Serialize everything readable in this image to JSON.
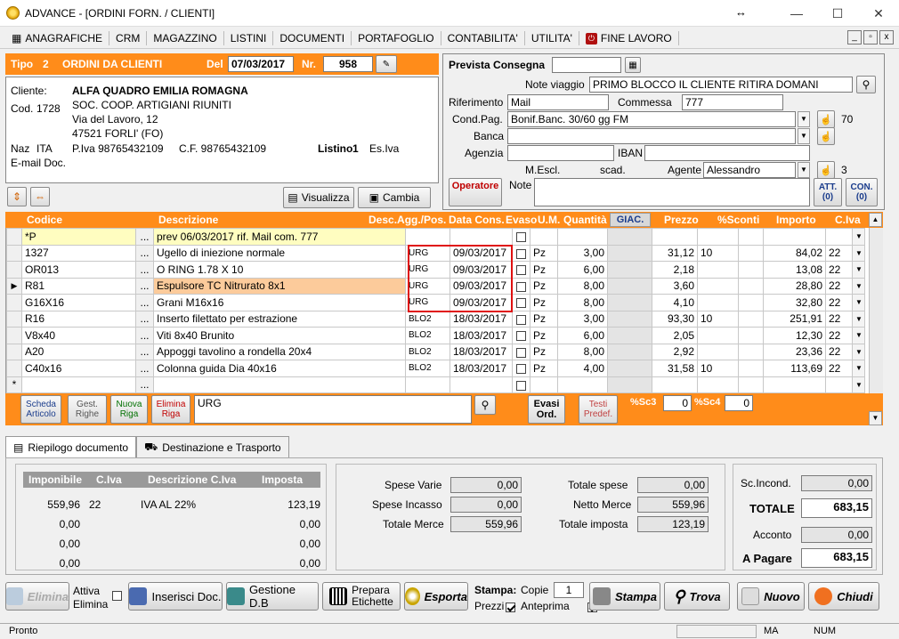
{
  "window": {
    "title": "ADVANCE - [ORDINI FORN. / CLIENTI]",
    "resize_glyph": "↔",
    "minimize": "—",
    "maximize": "☐",
    "close": "✕"
  },
  "menu": {
    "items": [
      "ANAGRAFICHE",
      "CRM",
      "MAGAZZINO",
      "LISTINI",
      "DOCUMENTI",
      "PORTAFOGLIO",
      "CONTABILITA'",
      "UTILITA'",
      "FINE LAVORO"
    ]
  },
  "mdi": {
    "min": "_",
    "restore": "▫",
    "close": "x"
  },
  "header": {
    "tipo_label": "Tipo",
    "tipo_num": "2",
    "tipo_desc": "ORDINI DA CLIENTI",
    "del_label": "Del",
    "date": "07/03/2017",
    "nr_label": "Nr.",
    "nr": "958"
  },
  "client": {
    "label": "Cliente:",
    "name": "ALFA QUADRO EMILIA ROMAGNA",
    "cod_label": "Cod.",
    "cod": "1728",
    "line2": "SOC. COOP. ARTIGIANI RIUNITI",
    "address": "Via del Lavoro, 12",
    "city": "47521 FORLI' (FO)",
    "naz_label": "Naz",
    "naz": "ITA",
    "piva": "P.Iva 98765432109",
    "cf": "C.F. 98765432109",
    "listino_label": "Listino",
    "listino": "1",
    "esiva": "Es.Iva",
    "email_label": "E-mail Doc."
  },
  "buttons": {
    "visualizza": "Visualizza",
    "cambia": "Cambia",
    "operatore": "Operatore",
    "att": "ATT.",
    "att_count": "(0)",
    "con": "CON.",
    "con_count": "(0)"
  },
  "right": {
    "prevista_label": "Prevista Consegna",
    "note_viaggio_label": "Note viaggio",
    "note_viaggio": "PRIMO BLOCCO IL CLIENTE RITIRA DOMANI",
    "riferimento_label": "Riferimento",
    "riferimento": "Mail",
    "commessa_label": "Commessa",
    "commessa": "777",
    "condpag_label": "Cond.Pag.",
    "condpag": "Bonif.Banc. 30/60 gg FM",
    "condpag_num": "70",
    "banca_label": "Banca",
    "agenzia_label": "Agenzia",
    "iban_label": "IBAN",
    "mescl_label": "M.Escl.",
    "scad_label": "scad.",
    "agente_label": "Agente",
    "agente": "Alessandro",
    "agente_num": "3",
    "note_label": "Note"
  },
  "grid": {
    "columns": [
      "Codice",
      "Descrizione",
      "Desc.Agg./Pos.",
      "Data Cons.",
      "Evaso",
      "U.M.",
      "Quantità",
      "GIAC.",
      "Prezzo",
      "%Sconti",
      "Importo",
      "C.Iva"
    ],
    "rows": [
      {
        "codice": "*P",
        "desc": "prev 06/03/2017 rif. Mail com. 777",
        "pos": "",
        "data": "",
        "um": "",
        "qta": "",
        "prezzo": "",
        "sconto": "",
        "importo": "",
        "iva": ""
      },
      {
        "codice": "1327",
        "desc": "Ugello di iniezione normale",
        "pos": "URG",
        "data": "09/03/2017",
        "um": "Pz",
        "qta": "3,00",
        "prezzo": "31,12",
        "sconto": "10",
        "importo": "84,02",
        "iva": "22"
      },
      {
        "codice": "OR013",
        "desc": "O RING 1.78 X 10",
        "pos": "URG",
        "data": "09/03/2017",
        "um": "Pz",
        "qta": "6,00",
        "prezzo": "2,18",
        "sconto": "",
        "importo": "13,08",
        "iva": "22"
      },
      {
        "codice": "R81",
        "desc": "Espulsore TC Nitrurato 8x1",
        "pos": "URG",
        "data": "09/03/2017",
        "um": "Pz",
        "qta": "8,00",
        "prezzo": "3,60",
        "sconto": "",
        "importo": "28,80",
        "iva": "22"
      },
      {
        "codice": "G16X16",
        "desc": "Grani  M16x16",
        "pos": "URG",
        "data": "09/03/2017",
        "um": "Pz",
        "qta": "8,00",
        "prezzo": "4,10",
        "sconto": "",
        "importo": "32,80",
        "iva": "22"
      },
      {
        "codice": "R16",
        "desc": "Inserto filettato per estrazione",
        "pos": "BLO2",
        "data": "18/03/2017",
        "um": "Pz",
        "qta": "3,00",
        "prezzo": "93,30",
        "sconto": "10",
        "importo": "251,91",
        "iva": "22"
      },
      {
        "codice": "V8x40",
        "desc": "Viti 8x40 Brunito",
        "pos": "BLO2",
        "data": "18/03/2017",
        "um": "Pz",
        "qta": "6,00",
        "prezzo": "2,05",
        "sconto": "",
        "importo": "12,30",
        "iva": "22"
      },
      {
        "codice": "A20",
        "desc": "Appoggi tavolino a rondella 20x4",
        "pos": "BLO2",
        "data": "18/03/2017",
        "um": "Pz",
        "qta": "8,00",
        "prezzo": "2,92",
        "sconto": "",
        "importo": "23,36",
        "iva": "22"
      },
      {
        "codice": "C40x16",
        "desc": "Colonna guida Dia 40x16",
        "pos": "BLO2",
        "data": "18/03/2017",
        "um": "Pz",
        "qta": "4,00",
        "prezzo": "31,58",
        "sconto": "10",
        "importo": "113,69",
        "iva": "22"
      },
      {
        "codice": "",
        "desc": "",
        "pos": "",
        "data": "",
        "um": "",
        "qta": "",
        "prezzo": "",
        "sconto": "",
        "importo": "",
        "iva": ""
      }
    ],
    "new_row_marker": "*"
  },
  "gridbar": {
    "scheda": "Scheda",
    "articolo": "Articolo",
    "gest": "Gest.",
    "righe": "Righe",
    "nuova": "Nuova",
    "riga": "Riga",
    "elimina": "Elimina",
    "riga2": "Riga",
    "search": "URG",
    "evasi": "Evasi",
    "ord": "Ord.",
    "testi": "Testi",
    "predef": "Predef.",
    "sc3_label": "%Sc3",
    "sc3": "0",
    "sc4_label": "%Sc4",
    "sc4": "0"
  },
  "tabs": [
    "Riepilogo documento",
    "Destinazione e Trasporto"
  ],
  "summary": {
    "columns": [
      "Imponibile",
      "C.Iva",
      "Descrizione C.Iva",
      "Imposta"
    ],
    "rows": [
      [
        "559,96",
        "22",
        "IVA AL 22%",
        "123,19"
      ],
      [
        "0,00",
        "",
        "",
        "0,00"
      ],
      [
        "0,00",
        "",
        "",
        "0,00"
      ],
      [
        "0,00",
        "",
        "",
        "0,00"
      ]
    ],
    "spese_varie_label": "Spese Varie",
    "spese_varie": "0,00",
    "spese_incasso_label": "Spese Incasso",
    "spese_incasso": "0,00",
    "totale_merce_label": "Totale Merce",
    "totale_merce": "559,96",
    "totale_spese_label": "Totale spese",
    "totale_spese": "0,00",
    "netto_merce_label": "Netto Merce",
    "netto_merce": "559,96",
    "totale_imposta_label": "Totale imposta",
    "totale_imposta": "123,19",
    "sc_incond_label": "Sc.Incond.",
    "sc_incond": "0,00",
    "totale_label": "TOTALE",
    "totale": "683,15",
    "acconto_label": "Acconto",
    "acconto": "0,00",
    "apagare_label": "A Pagare",
    "apagare": "683,15"
  },
  "bottom": {
    "elimina": "Elimina",
    "attiva": "Attiva",
    "elimina2": "Elimina",
    "inserisci": "Inserisci Doc.",
    "gestione": "Gestione D.B",
    "prepara": "Prepara",
    "etichette": "Etichette",
    "esporta": "Esporta",
    "stampa_label": "Stampa:",
    "copie_label": "Copie",
    "copie": "1",
    "prezzi_label": "Prezzi",
    "anteprima_label": "Anteprima",
    "stampa": "Stampa",
    "trova": "Trova",
    "nuovo": "Nuovo",
    "chiudi": "Chiudi"
  },
  "status": {
    "text": "Pronto",
    "ma": "MA",
    "num": "NUM"
  }
}
